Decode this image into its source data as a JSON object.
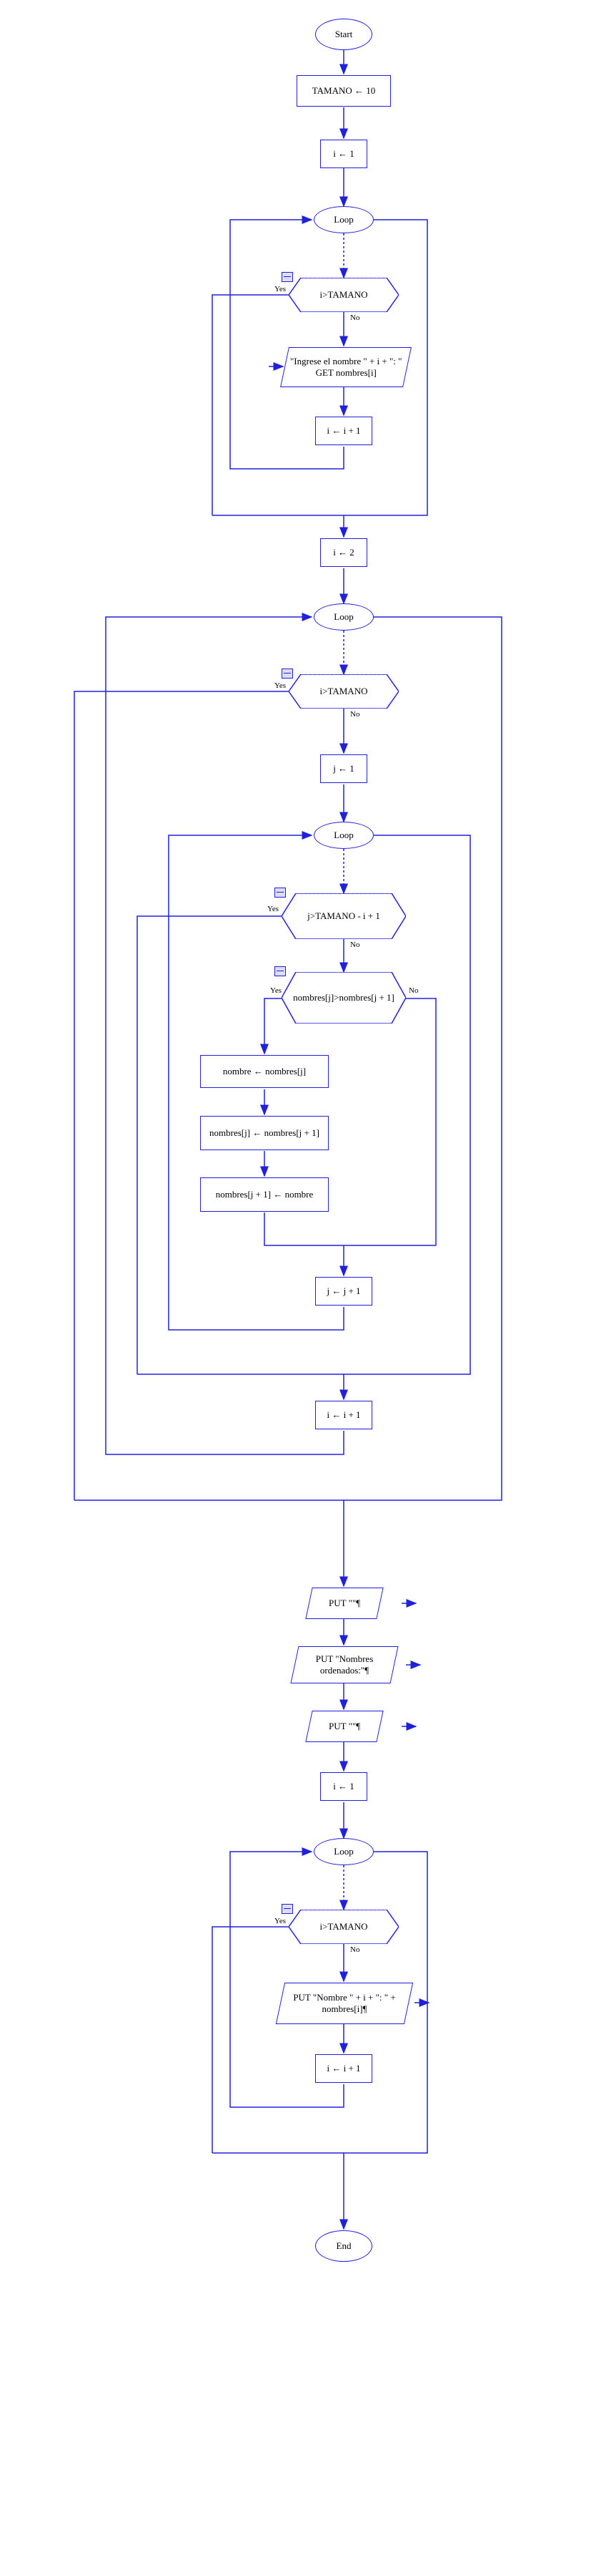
{
  "chart_data": {
    "type": "flowchart",
    "nodes": [
      {
        "id": "start",
        "type": "terminator",
        "label": "Start"
      },
      {
        "id": "n1",
        "type": "process",
        "label": "TAMANO ← 10"
      },
      {
        "id": "n2",
        "type": "process",
        "label": "i ← 1"
      },
      {
        "id": "loop1",
        "type": "loop",
        "label": "Loop"
      },
      {
        "id": "d1",
        "type": "decision",
        "label": "i>TAMANO",
        "yes": "exit",
        "no": "body"
      },
      {
        "id": "io1",
        "type": "io",
        "label": "\"Ingrese el nombre \" + i + \": \"\nGET nombres[i]"
      },
      {
        "id": "inc1",
        "type": "process",
        "label": "i ← i + 1"
      },
      {
        "id": "n3",
        "type": "process",
        "label": "i ← 2"
      },
      {
        "id": "loop2",
        "type": "loop",
        "label": "Loop"
      },
      {
        "id": "d2",
        "type": "decision",
        "label": "i>TAMANO",
        "yes": "exit",
        "no": "body"
      },
      {
        "id": "n4",
        "type": "process",
        "label": "j ← 1"
      },
      {
        "id": "loop3",
        "type": "loop",
        "label": "Loop"
      },
      {
        "id": "d3",
        "type": "decision",
        "label": "j>TAMANO - i + 1",
        "yes": "exit",
        "no": "body"
      },
      {
        "id": "d4",
        "type": "decision",
        "label": "nombres[j]>nombres[j + 1]",
        "yes": "swap",
        "no": "skip"
      },
      {
        "id": "s1",
        "type": "process",
        "label": "nombre ← nombres[j]"
      },
      {
        "id": "s2",
        "type": "process",
        "label": "nombres[j] ← nombres[j + 1]"
      },
      {
        "id": "s3",
        "type": "process",
        "label": "nombres[j + 1] ← nombre"
      },
      {
        "id": "inc3",
        "type": "process",
        "label": "j ← j + 1"
      },
      {
        "id": "inc2",
        "type": "process",
        "label": "i ← i + 1"
      },
      {
        "id": "out1",
        "type": "output",
        "label": "PUT \"\"¶"
      },
      {
        "id": "out2",
        "type": "output",
        "label": "PUT \"Nombres ordenados:\"¶"
      },
      {
        "id": "out3",
        "type": "output",
        "label": "PUT \"\"¶"
      },
      {
        "id": "n5",
        "type": "process",
        "label": "i ← 1"
      },
      {
        "id": "loop4",
        "type": "loop",
        "label": "Loop"
      },
      {
        "id": "d5",
        "type": "decision",
        "label": "i>TAMANO",
        "yes": "exit",
        "no": "body"
      },
      {
        "id": "out4",
        "type": "output",
        "label": "PUT \"Nombre \" + i + \": \" + nombres[i]¶"
      },
      {
        "id": "inc4",
        "type": "process",
        "label": "i ← i + 1"
      },
      {
        "id": "end",
        "type": "terminator",
        "label": "End"
      }
    ],
    "labels": {
      "yes": "Yes",
      "no": "No"
    }
  },
  "nodes": {
    "start": "Start",
    "n1": "TAMANO ← 10",
    "n2": "i ← 1",
    "loop1": "Loop",
    "d1": "i>TAMANO",
    "io1_line1": "\"Ingrese el nombre \" + i + \": \"",
    "io1_line2": "GET nombres[i]",
    "inc1": "i ← i + 1",
    "n3": "i ← 2",
    "loop2": "Loop",
    "d2": "i>TAMANO",
    "n4": "j ← 1",
    "loop3": "Loop",
    "d3": "j>TAMANO - i + 1",
    "d4": "nombres[j]>nombres[j + 1]",
    "s1": "nombre ← nombres[j]",
    "s2": "nombres[j] ← nombres[j + 1]",
    "s3": "nombres[j + 1] ← nombre",
    "inc3": "j ← j + 1",
    "inc2": "i ← i + 1",
    "out1": "PUT \"\"¶",
    "out2": "PUT \"Nombres ordenados:\"¶",
    "out3": "PUT \"\"¶",
    "n5": "i ← 1",
    "loop4": "Loop",
    "d5": "i>TAMANO",
    "out4": "PUT \"Nombre \" + i + \": \" + nombres[i]¶",
    "inc4": "i ← i + 1",
    "end": "End"
  },
  "labels": {
    "yes": "Yes",
    "no": "No"
  }
}
